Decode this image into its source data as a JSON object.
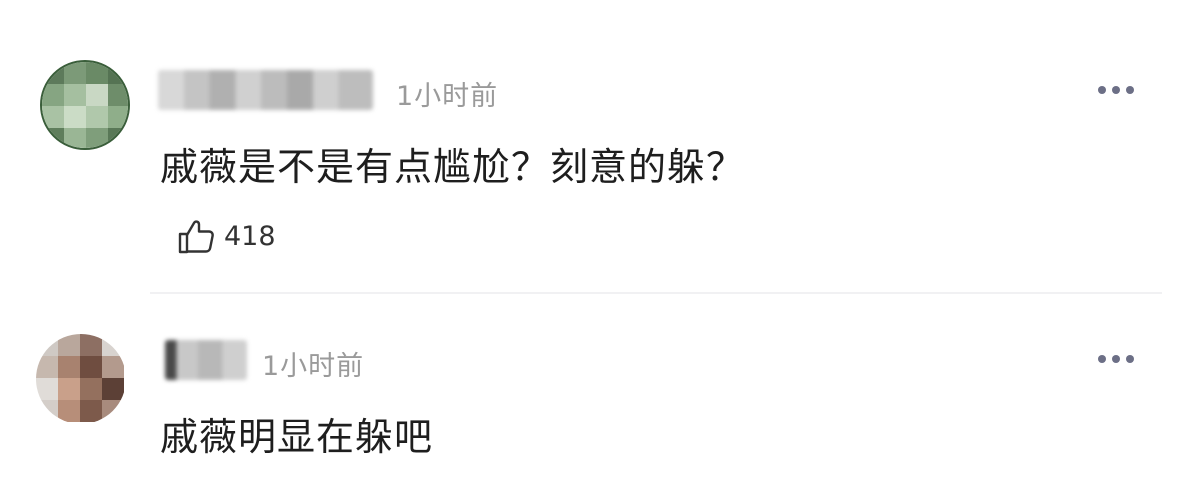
{
  "comments": [
    {
      "time": "1小时前",
      "text": "戚薇是不是有点尴尬？刻意的躲？",
      "likes": "418",
      "avatar_icon": "green-pixelated-avatar",
      "more_icon": "more-dots-icon"
    },
    {
      "time": "1小时前",
      "text": "戚薇明显在躲吧",
      "avatar_icon": "brown-pixelated-avatar",
      "more_icon": "more-dots-icon"
    }
  ],
  "colors": {
    "time": "#9a9a9a",
    "text": "#1e1e1e",
    "dots": "#6c6f86"
  }
}
